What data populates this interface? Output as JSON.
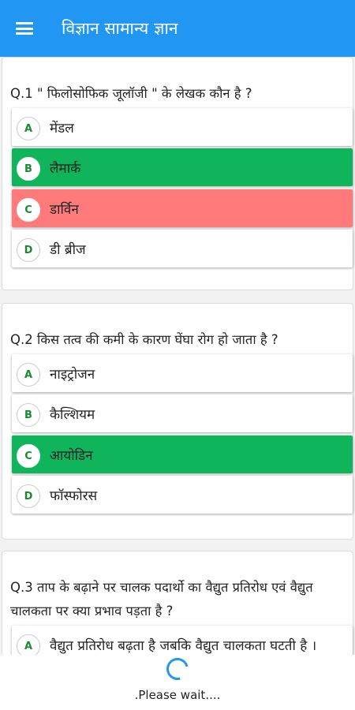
{
  "appbar": {
    "title": "विज्ञान सामान्य ज्ञान",
    "menu_icon": "hamburger-menu-icon"
  },
  "colors": {
    "primary": "#2196f3",
    "correct": "#10b45a",
    "wrong": "#ff7b7b",
    "letter": "#1a8a2e"
  },
  "questions": [
    {
      "text": "Q.1 \" फिलोसोफिक जूलॉजी \" के लेखक कौन है ?",
      "options": [
        {
          "letter": "A",
          "text": "मेंडल",
          "state": "normal"
        },
        {
          "letter": "B",
          "text": "लैमार्क",
          "state": "correct"
        },
        {
          "letter": "C",
          "text": "डार्विन",
          "state": "wrong"
        },
        {
          "letter": "D",
          "text": "डी ब्रीज",
          "state": "normal"
        }
      ]
    },
    {
      "text": "Q.2 किस तत्व की कमी के कारण घेंघा रोग हो जाता है ?",
      "options": [
        {
          "letter": "A",
          "text": "नाइट्रोजन",
          "state": "normal"
        },
        {
          "letter": "B",
          "text": "कैल्शियम",
          "state": "normal"
        },
        {
          "letter": "C",
          "text": "आयोडिन",
          "state": "correct"
        },
        {
          "letter": "D",
          "text": "फॉस्फोरस",
          "state": "normal"
        }
      ]
    },
    {
      "text_line1": "Q.3 ताप के बढ़ाने पर चालक पदार्थो का वैद्युत प्रतिरोध एवं वैद्युत",
      "text_line2": "चालकता पर क्या प्रभाव पड़ता है ?",
      "options": [
        {
          "letter": "A",
          "text": "वैद्युत प्रतिरोध बढ़ता है जबकि वैद्युत चालकता घटती है ।",
          "state": "normal"
        }
      ]
    }
  ],
  "loader": {
    "text": ".Please wait...."
  }
}
